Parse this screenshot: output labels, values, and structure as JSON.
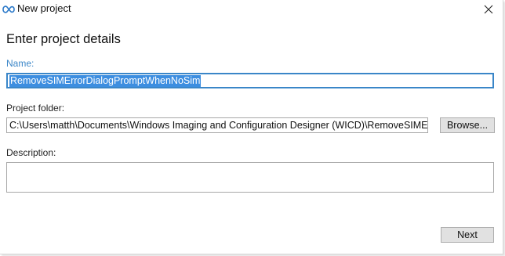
{
  "window": {
    "title": "New project",
    "app_icon": "wicd-app-icon",
    "close_icon": "close-icon"
  },
  "form": {
    "heading": "Enter project details",
    "name": {
      "label": "Name:",
      "value": "RemoveSIMErrorDialogPromptWhenNoSim"
    },
    "folder": {
      "label": "Project folder:",
      "value": "C:\\Users\\matth\\Documents\\Windows Imaging and Configuration Designer (WICD)\\RemoveSIMErrorD",
      "browse_label": "Browse..."
    },
    "description": {
      "label": "Description:",
      "value": ""
    }
  },
  "footer": {
    "next_label": "Next"
  },
  "colors": {
    "accent": "#3a86c8",
    "selection": "#3d8ee0",
    "button_face": "#e1e1e1"
  }
}
